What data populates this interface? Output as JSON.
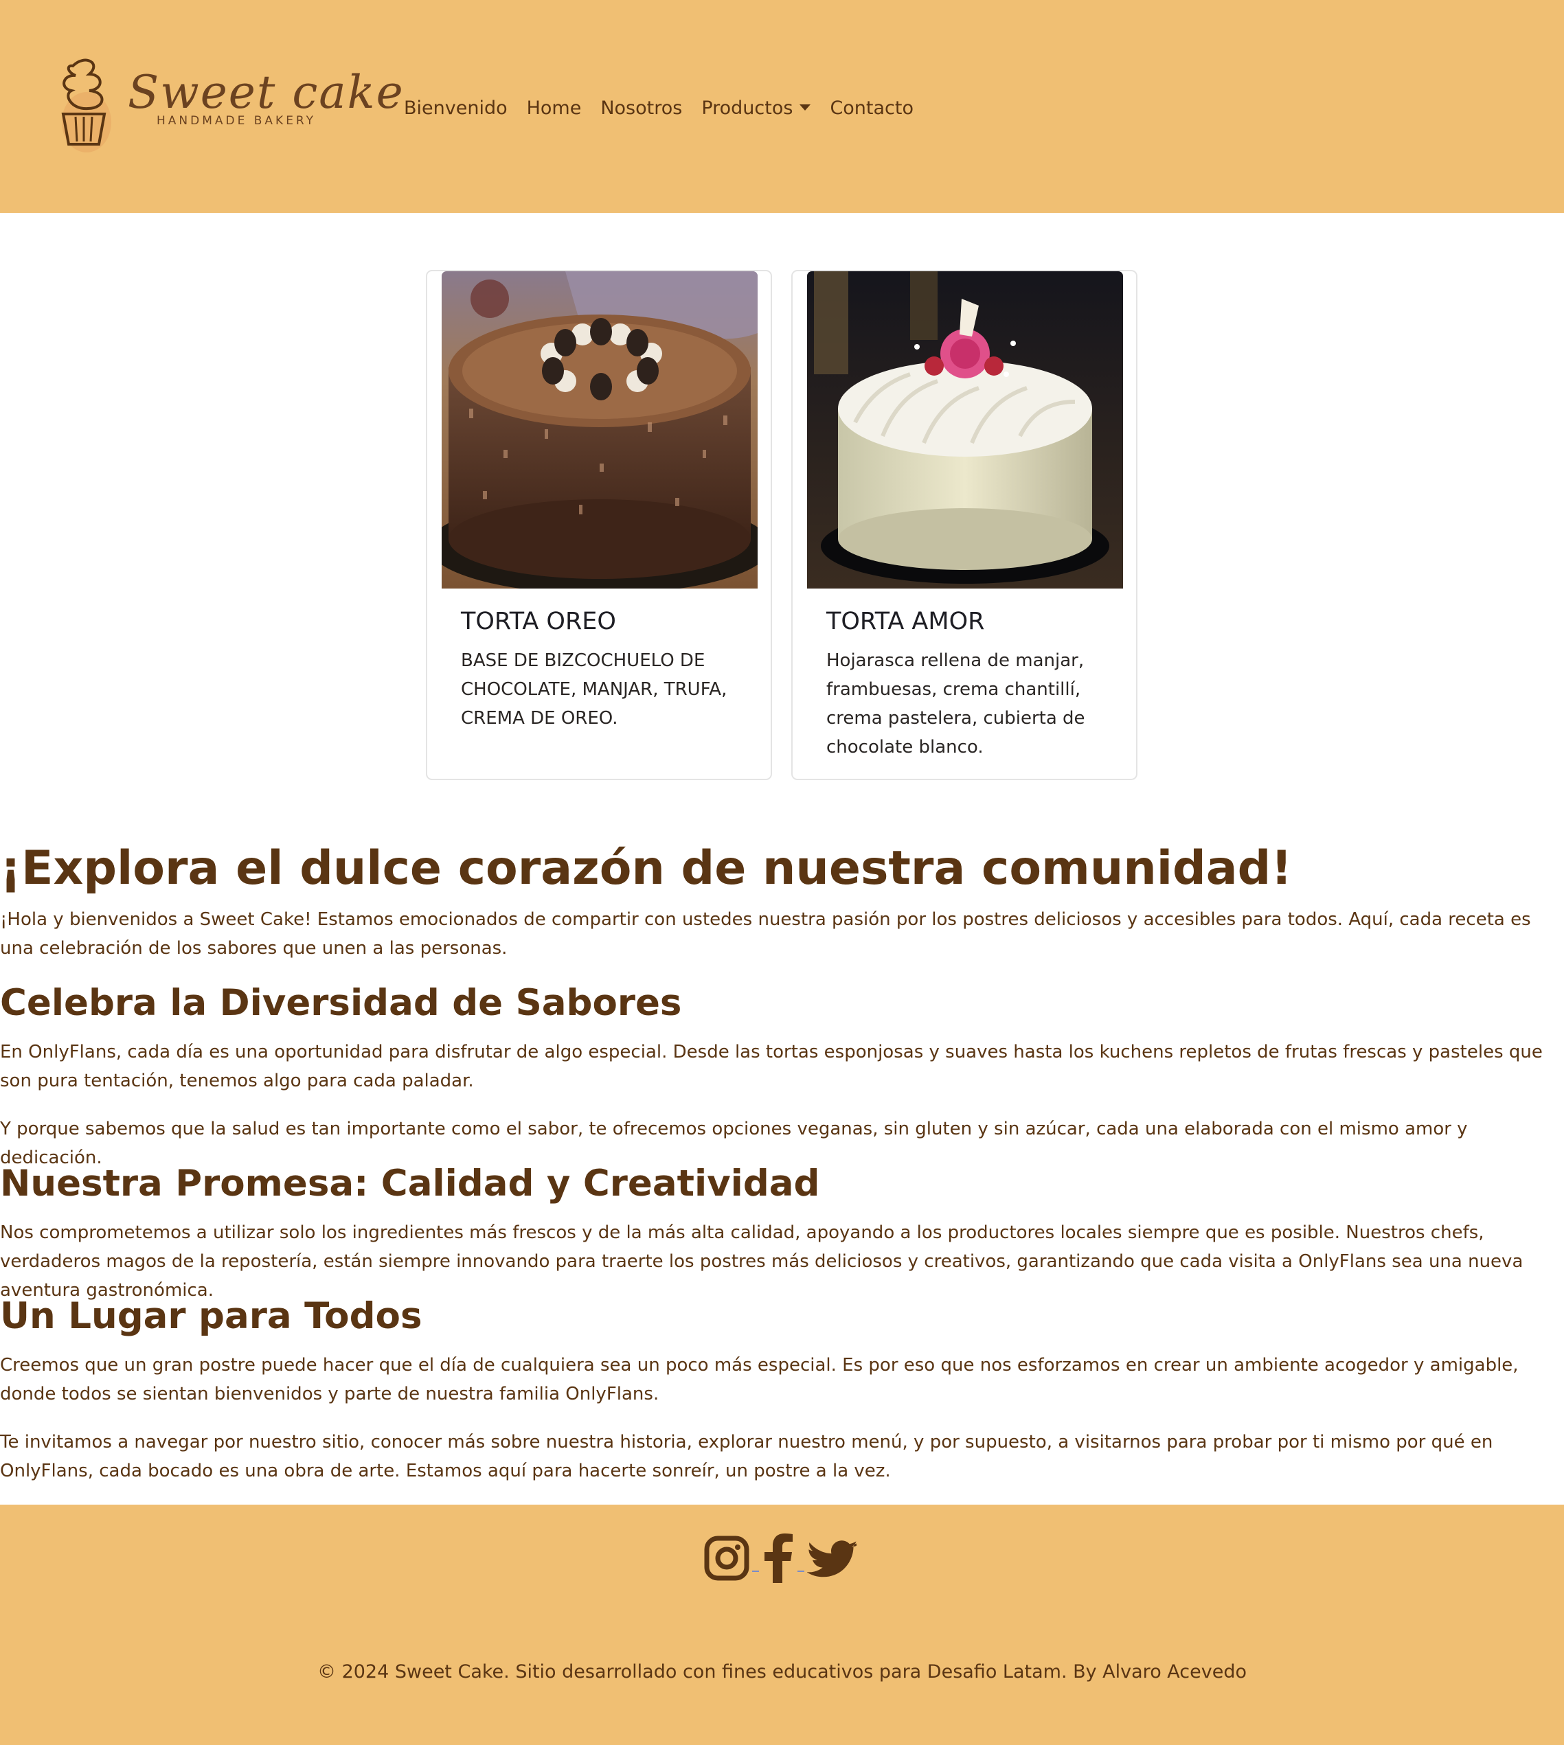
{
  "brand": {
    "name": "Sweet cake",
    "tagline": "HANDMADE BAKERY"
  },
  "nav": {
    "items": [
      {
        "label": "Bienvenido"
      },
      {
        "label": "Home"
      },
      {
        "label": "Nosotros"
      },
      {
        "label": "Productos",
        "has_dropdown": true
      },
      {
        "label": "Contacto"
      }
    ]
  },
  "products": [
    {
      "title": "TORTA OREO",
      "description": "BASE DE BIZCOCHUELO DE CHOCOLATE, MANJAR, TRUFA, CREMA DE OREO."
    },
    {
      "title": "TORTA AMOR",
      "description": "Hojarasca rellena de manjar, frambuesas, crema chantillí, crema pastelera, cubierta de chocolate blanco."
    }
  ],
  "article": {
    "heading": "¡Explora el dulce corazón de nuestra comunidad!",
    "intro": "¡Hola y bienvenidos a Sweet Cake! Estamos emocionados de compartir con ustedes nuestra pasión por los postres deliciosos y accesibles para todos. Aquí, cada receta es una celebración de los sabores que unen a las personas.",
    "sections": [
      {
        "title": "Celebra la Diversidad de Sabores",
        "paragraphs": [
          "En OnlyFlans, cada día es una oportunidad para disfrutar de algo especial. Desde las tortas esponjosas y suaves hasta los kuchens repletos de frutas frescas y pasteles que son pura tentación, tenemos algo para cada paladar.",
          "Y porque sabemos que la salud es tan importante como el sabor, te ofrecemos opciones veganas, sin gluten y sin azúcar, cada una elaborada con el mismo amor y dedicación."
        ]
      },
      {
        "title": "Nuestra Promesa: Calidad y Creatividad",
        "paragraphs": [
          "Nos comprometemos a utilizar solo los ingredientes más frescos y de la más alta calidad, apoyando a los productores locales siempre que es posible. Nuestros chefs, verdaderos magos de la repostería, están siempre innovando para traerte los postres más deliciosos y creativos, garantizando que cada visita a OnlyFlans sea una nueva aventura gastronómica."
        ]
      },
      {
        "title": "Un Lugar para Todos",
        "paragraphs": [
          "Creemos que un gran postre puede hacer que el día de cualquiera sea un poco más especial. Es por eso que nos esforzamos en crear un ambiente acogedor y amigable, donde todos se sientan bienvenidos y parte de nuestra familia OnlyFlans.",
          "Te invitamos a navegar por nuestro sitio, conocer más sobre nuestra historia, explorar nuestro menú, y por supuesto, a visitarnos para probar por ti mismo por qué en OnlyFlans, cada bocado es una obra de arte. Estamos aquí para hacerte sonreír, un postre a la vez."
        ]
      }
    ]
  },
  "footer": {
    "social": [
      {
        "icon": "instagram-icon"
      },
      {
        "icon": "facebook-icon"
      },
      {
        "icon": "twitter-icon"
      }
    ],
    "copyright": "© 2024 Sweet Cake. Sitio desarrollado con fines educativos para Desafio Latam. By Alvaro Acevedo"
  },
  "colors": {
    "header_bg": "#f0bf73",
    "text_brown": "#5a3513",
    "card_title": "#1e1e24"
  }
}
